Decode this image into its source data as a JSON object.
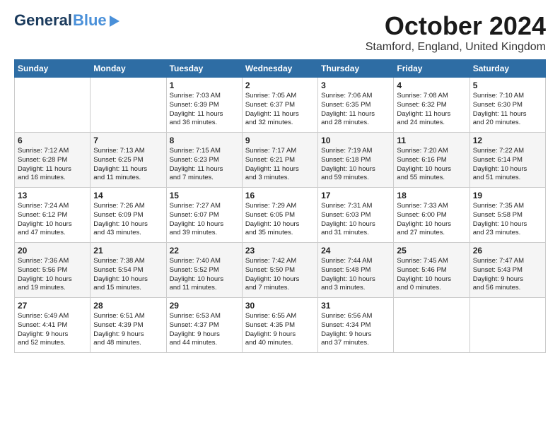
{
  "header": {
    "logo_general": "General",
    "logo_blue": "Blue",
    "title": "October 2024",
    "subtitle": "Stamford, England, United Kingdom"
  },
  "calendar": {
    "headers": [
      "Sunday",
      "Monday",
      "Tuesday",
      "Wednesday",
      "Thursday",
      "Friday",
      "Saturday"
    ],
    "weeks": [
      [
        {
          "day": "",
          "lines": []
        },
        {
          "day": "",
          "lines": []
        },
        {
          "day": "1",
          "lines": [
            "Sunrise: 7:03 AM",
            "Sunset: 6:39 PM",
            "Daylight: 11 hours",
            "and 36 minutes."
          ]
        },
        {
          "day": "2",
          "lines": [
            "Sunrise: 7:05 AM",
            "Sunset: 6:37 PM",
            "Daylight: 11 hours",
            "and 32 minutes."
          ]
        },
        {
          "day": "3",
          "lines": [
            "Sunrise: 7:06 AM",
            "Sunset: 6:35 PM",
            "Daylight: 11 hours",
            "and 28 minutes."
          ]
        },
        {
          "day": "4",
          "lines": [
            "Sunrise: 7:08 AM",
            "Sunset: 6:32 PM",
            "Daylight: 11 hours",
            "and 24 minutes."
          ]
        },
        {
          "day": "5",
          "lines": [
            "Sunrise: 7:10 AM",
            "Sunset: 6:30 PM",
            "Daylight: 11 hours",
            "and 20 minutes."
          ]
        }
      ],
      [
        {
          "day": "6",
          "lines": [
            "Sunrise: 7:12 AM",
            "Sunset: 6:28 PM",
            "Daylight: 11 hours",
            "and 16 minutes."
          ]
        },
        {
          "day": "7",
          "lines": [
            "Sunrise: 7:13 AM",
            "Sunset: 6:25 PM",
            "Daylight: 11 hours",
            "and 11 minutes."
          ]
        },
        {
          "day": "8",
          "lines": [
            "Sunrise: 7:15 AM",
            "Sunset: 6:23 PM",
            "Daylight: 11 hours",
            "and 7 minutes."
          ]
        },
        {
          "day": "9",
          "lines": [
            "Sunrise: 7:17 AM",
            "Sunset: 6:21 PM",
            "Daylight: 11 hours",
            "and 3 minutes."
          ]
        },
        {
          "day": "10",
          "lines": [
            "Sunrise: 7:19 AM",
            "Sunset: 6:18 PM",
            "Daylight: 10 hours",
            "and 59 minutes."
          ]
        },
        {
          "day": "11",
          "lines": [
            "Sunrise: 7:20 AM",
            "Sunset: 6:16 PM",
            "Daylight: 10 hours",
            "and 55 minutes."
          ]
        },
        {
          "day": "12",
          "lines": [
            "Sunrise: 7:22 AM",
            "Sunset: 6:14 PM",
            "Daylight: 10 hours",
            "and 51 minutes."
          ]
        }
      ],
      [
        {
          "day": "13",
          "lines": [
            "Sunrise: 7:24 AM",
            "Sunset: 6:12 PM",
            "Daylight: 10 hours",
            "and 47 minutes."
          ]
        },
        {
          "day": "14",
          "lines": [
            "Sunrise: 7:26 AM",
            "Sunset: 6:09 PM",
            "Daylight: 10 hours",
            "and 43 minutes."
          ]
        },
        {
          "day": "15",
          "lines": [
            "Sunrise: 7:27 AM",
            "Sunset: 6:07 PM",
            "Daylight: 10 hours",
            "and 39 minutes."
          ]
        },
        {
          "day": "16",
          "lines": [
            "Sunrise: 7:29 AM",
            "Sunset: 6:05 PM",
            "Daylight: 10 hours",
            "and 35 minutes."
          ]
        },
        {
          "day": "17",
          "lines": [
            "Sunrise: 7:31 AM",
            "Sunset: 6:03 PM",
            "Daylight: 10 hours",
            "and 31 minutes."
          ]
        },
        {
          "day": "18",
          "lines": [
            "Sunrise: 7:33 AM",
            "Sunset: 6:00 PM",
            "Daylight: 10 hours",
            "and 27 minutes."
          ]
        },
        {
          "day": "19",
          "lines": [
            "Sunrise: 7:35 AM",
            "Sunset: 5:58 PM",
            "Daylight: 10 hours",
            "and 23 minutes."
          ]
        }
      ],
      [
        {
          "day": "20",
          "lines": [
            "Sunrise: 7:36 AM",
            "Sunset: 5:56 PM",
            "Daylight: 10 hours",
            "and 19 minutes."
          ]
        },
        {
          "day": "21",
          "lines": [
            "Sunrise: 7:38 AM",
            "Sunset: 5:54 PM",
            "Daylight: 10 hours",
            "and 15 minutes."
          ]
        },
        {
          "day": "22",
          "lines": [
            "Sunrise: 7:40 AM",
            "Sunset: 5:52 PM",
            "Daylight: 10 hours",
            "and 11 minutes."
          ]
        },
        {
          "day": "23",
          "lines": [
            "Sunrise: 7:42 AM",
            "Sunset: 5:50 PM",
            "Daylight: 10 hours",
            "and 7 minutes."
          ]
        },
        {
          "day": "24",
          "lines": [
            "Sunrise: 7:44 AM",
            "Sunset: 5:48 PM",
            "Daylight: 10 hours",
            "and 3 minutes."
          ]
        },
        {
          "day": "25",
          "lines": [
            "Sunrise: 7:45 AM",
            "Sunset: 5:46 PM",
            "Daylight: 10 hours",
            "and 0 minutes."
          ]
        },
        {
          "day": "26",
          "lines": [
            "Sunrise: 7:47 AM",
            "Sunset: 5:43 PM",
            "Daylight: 9 hours",
            "and 56 minutes."
          ]
        }
      ],
      [
        {
          "day": "27",
          "lines": [
            "Sunrise: 6:49 AM",
            "Sunset: 4:41 PM",
            "Daylight: 9 hours",
            "and 52 minutes."
          ]
        },
        {
          "day": "28",
          "lines": [
            "Sunrise: 6:51 AM",
            "Sunset: 4:39 PM",
            "Daylight: 9 hours",
            "and 48 minutes."
          ]
        },
        {
          "day": "29",
          "lines": [
            "Sunrise: 6:53 AM",
            "Sunset: 4:37 PM",
            "Daylight: 9 hours",
            "and 44 minutes."
          ]
        },
        {
          "day": "30",
          "lines": [
            "Sunrise: 6:55 AM",
            "Sunset: 4:35 PM",
            "Daylight: 9 hours",
            "and 40 minutes."
          ]
        },
        {
          "day": "31",
          "lines": [
            "Sunrise: 6:56 AM",
            "Sunset: 4:34 PM",
            "Daylight: 9 hours",
            "and 37 minutes."
          ]
        },
        {
          "day": "",
          "lines": []
        },
        {
          "day": "",
          "lines": []
        }
      ]
    ]
  }
}
